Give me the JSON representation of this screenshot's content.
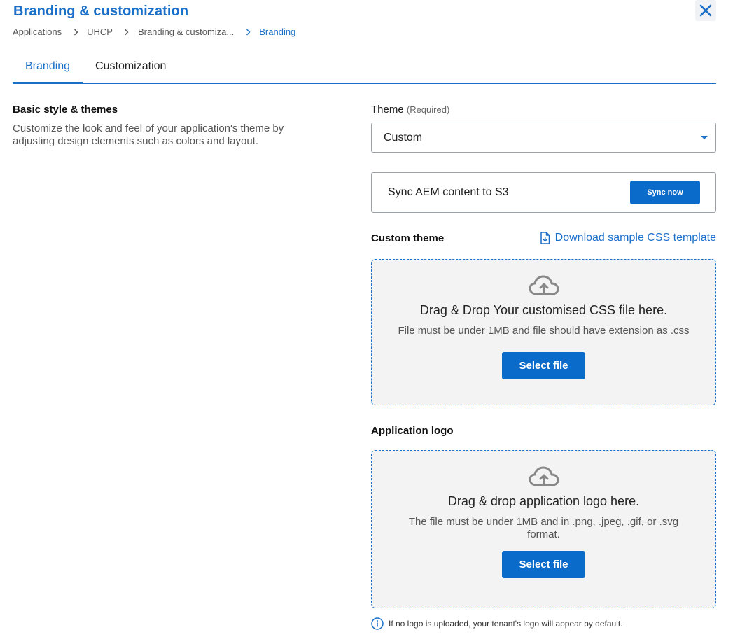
{
  "header": {
    "title": "Branding & customization",
    "close_icon": "close-icon"
  },
  "breadcrumb": {
    "items": [
      "Applications",
      "UHCP",
      "Branding & customiza...",
      "Branding"
    ]
  },
  "tabs": [
    {
      "label": "Branding",
      "active": true
    },
    {
      "label": "Customization",
      "active": false
    }
  ],
  "basic_style": {
    "title": "Basic style & themes",
    "description": "Customize the look and feel of your application's theme by adjusting design elements such as colors and layout."
  },
  "theme": {
    "label": "Theme",
    "required": "(Required)",
    "selected": "Custom"
  },
  "sync": {
    "text": "Sync AEM content to S3",
    "button_label": "Sync now"
  },
  "custom_theme": {
    "title": "Custom theme",
    "download_link": "Download sample CSS template",
    "dropzone_main": "Drag & Drop Your customised CSS file here.",
    "dropzone_sub": "File must be under 1MB and file should have extension as .css",
    "button_label": "Select file"
  },
  "app_logo": {
    "title": "Application logo",
    "dropzone_main": "Drag & drop application logo here.",
    "dropzone_sub": "The file must be under 1MB and in .png, .jpeg, .gif, or .svg format.",
    "button_label": "Select file",
    "info_note": "If no logo is uploaded, your tenant's logo will appear by default."
  },
  "colors": {
    "accent": "#1a6fc9",
    "button": "#0b6bcb",
    "dropzone_bg": "#f3f3f3"
  }
}
